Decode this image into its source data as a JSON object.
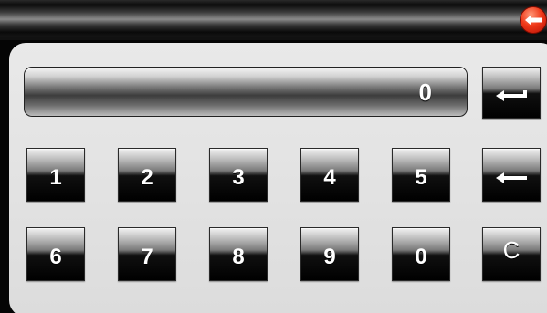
{
  "display": {
    "value": "0"
  },
  "keys": {
    "row1": [
      "1",
      "2",
      "3",
      "4",
      "5"
    ],
    "row2": [
      "6",
      "7",
      "8",
      "9",
      "0"
    ],
    "clear_label": "C"
  },
  "icons": {
    "back": "back-arrow-icon",
    "enter": "enter-return-icon",
    "backspace": "backspace-arrow-icon"
  },
  "colors": {
    "back_button": "#f03a1a",
    "panel": "#e3e3e3",
    "key_text": "#ffffff"
  }
}
